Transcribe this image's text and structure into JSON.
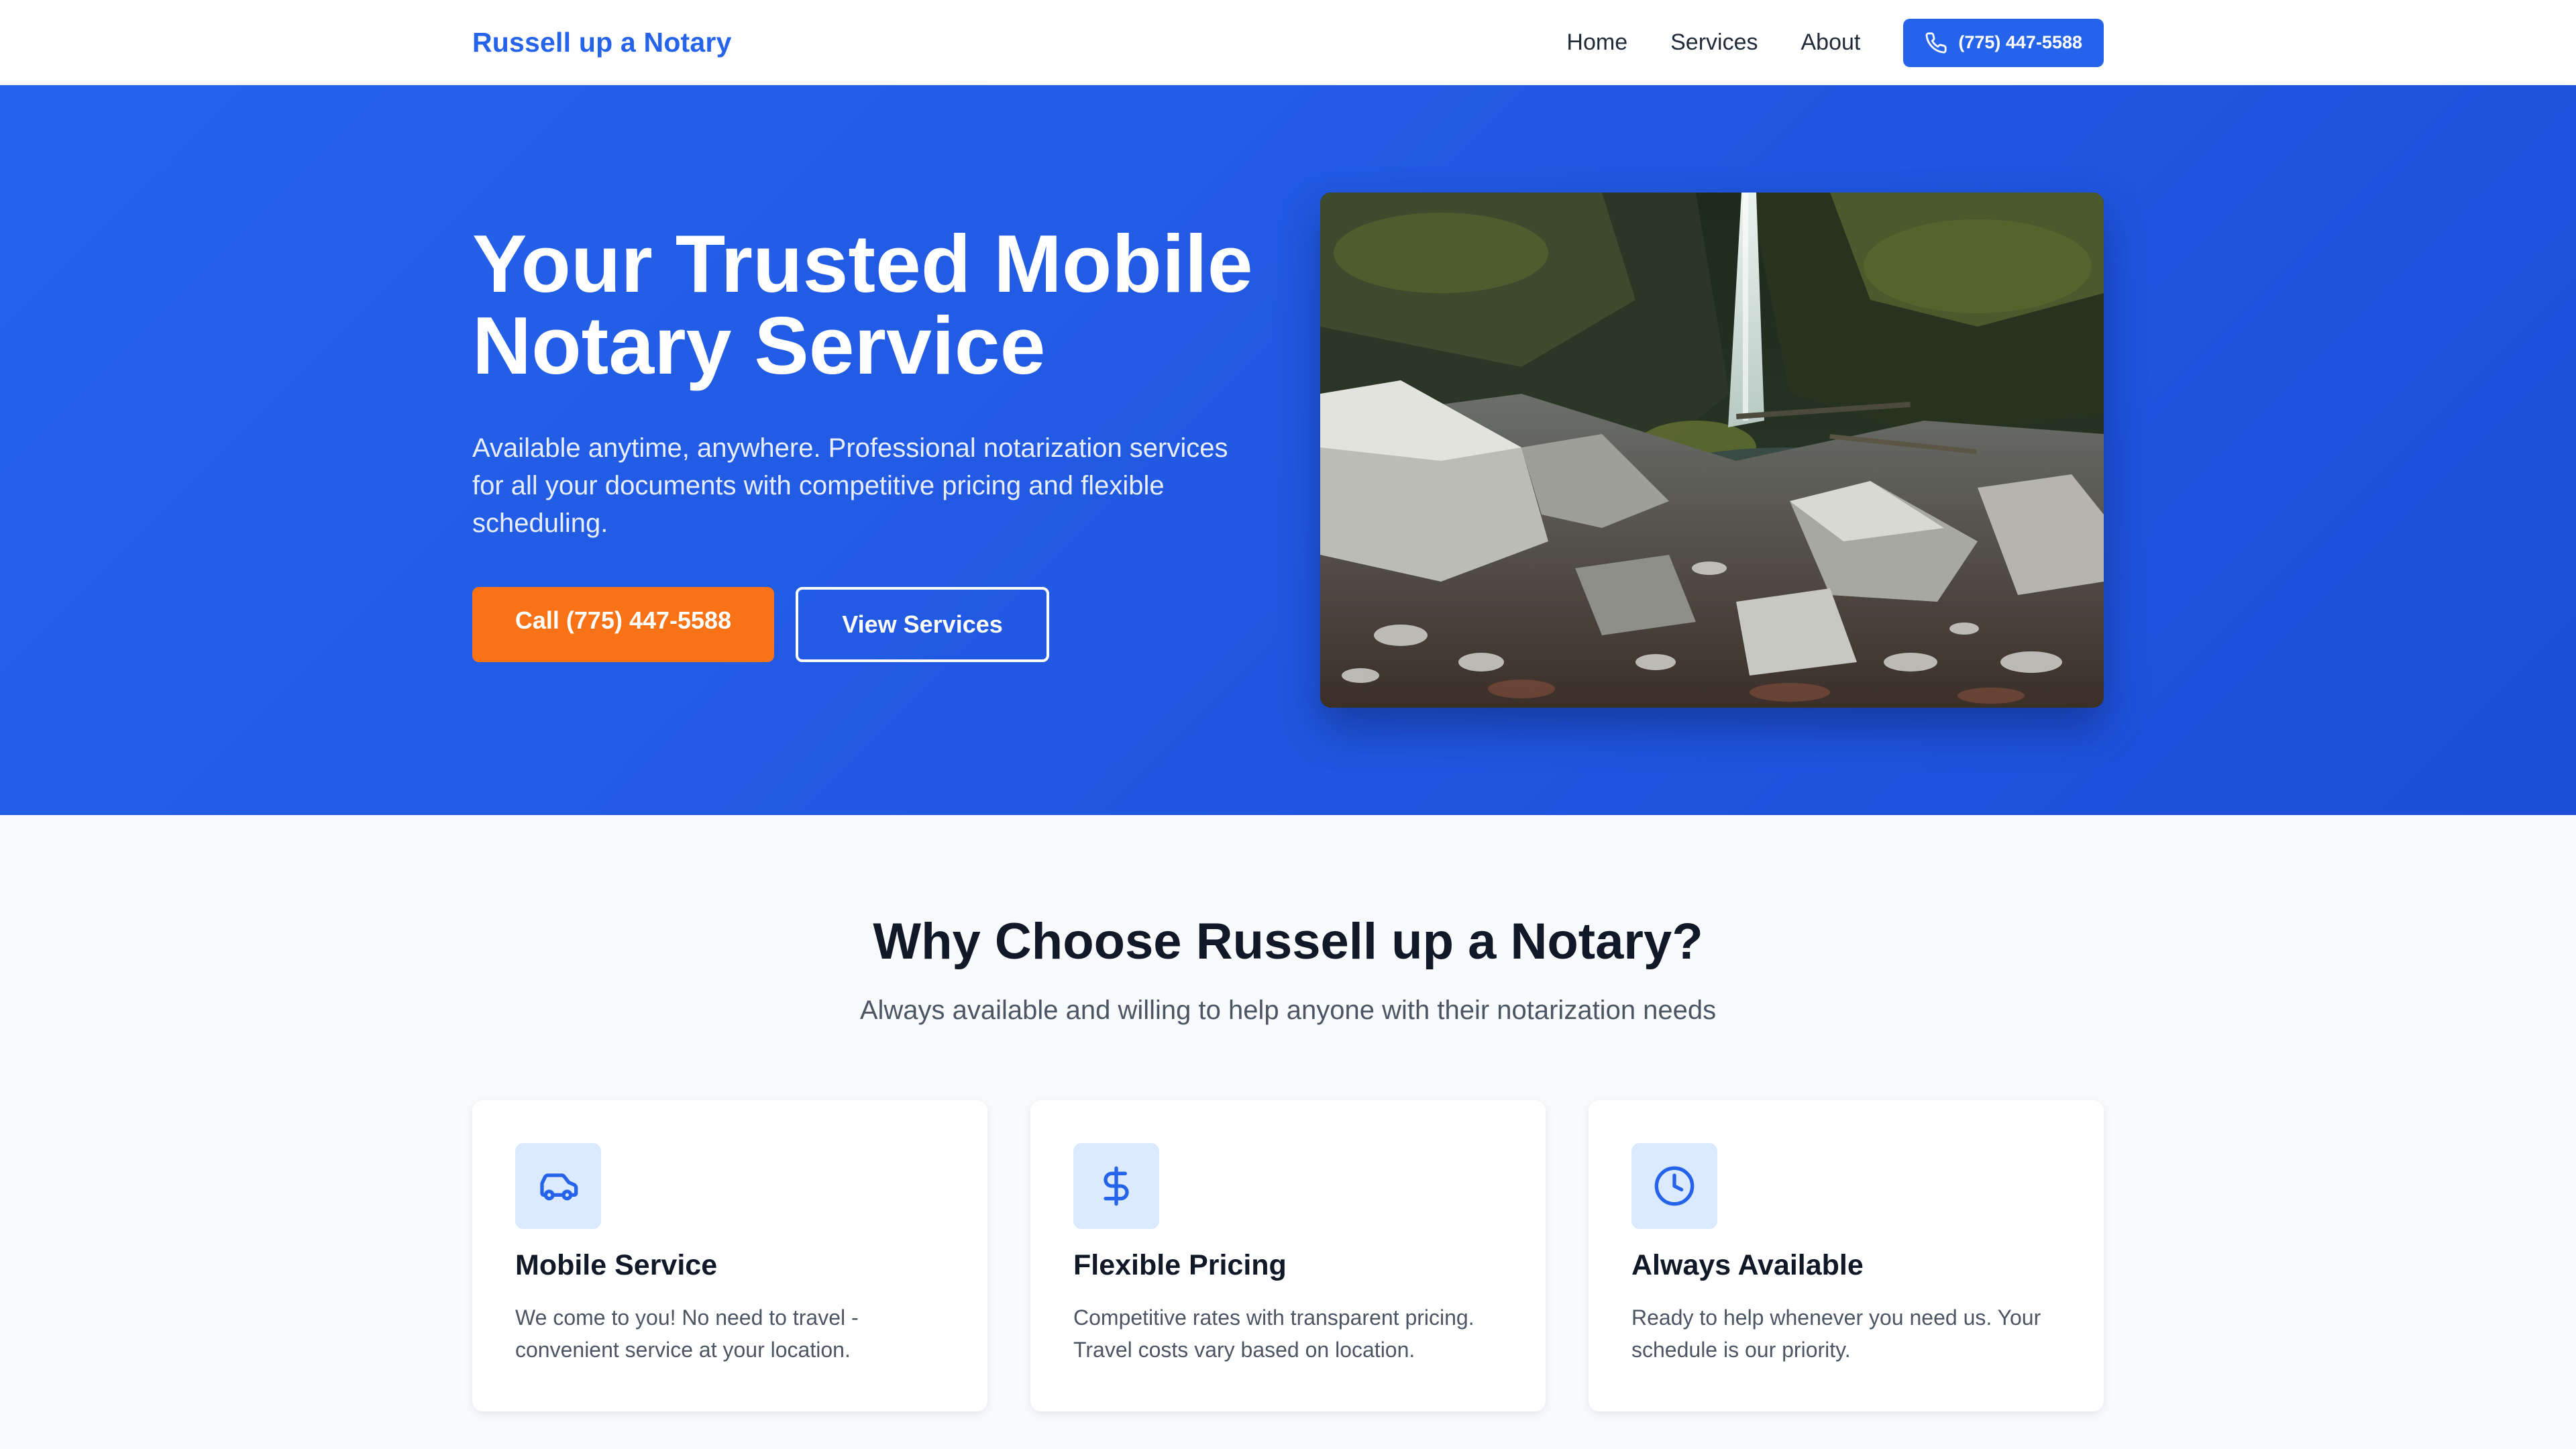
{
  "nav": {
    "brand": "Russell up a Notary",
    "links": [
      "Home",
      "Services",
      "About"
    ],
    "phone_button": "(775) 447-5588",
    "phone_icon": "phone-icon"
  },
  "hero": {
    "title": "Your Trusted Mobile Notary Service",
    "subtitle": "Available anytime, anywhere. Professional notarization services for all your documents with competitive pricing and flexible scheduling.",
    "call_button": "Call (775) 447-5588",
    "services_button": "View Services",
    "image": "waterfall-canyon-photo"
  },
  "features": {
    "title": "Why Choose Russell up a Notary?",
    "subtitle": "Always available and willing to help anyone with their notarization needs",
    "cards": [
      {
        "icon": "car-icon",
        "title": "Mobile Service",
        "text": "We come to you! No need to travel - convenient service at your location."
      },
      {
        "icon": "dollar-icon",
        "title": "Flexible Pricing",
        "text": "Competitive rates with transparent pricing. Travel costs vary based on location."
      },
      {
        "icon": "clock-icon",
        "title": "Always Available",
        "text": "Ready to help whenever you need us. Your schedule is our priority."
      }
    ]
  },
  "colors": {
    "primary": "#2563eb",
    "accent": "#f97316",
    "icon_bg": "#dbeafe",
    "text_dark": "#111827",
    "text_muted": "#4b5563"
  }
}
